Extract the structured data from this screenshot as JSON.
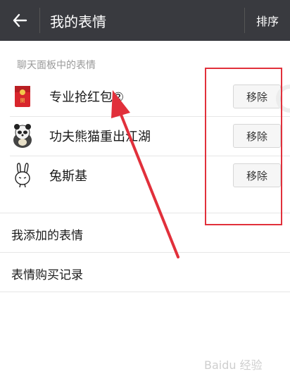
{
  "header": {
    "title": "我的表情",
    "sort_label": "排序"
  },
  "section": {
    "label": "聊天面板中的表情"
  },
  "stickers": [
    {
      "name": "专业抢红包②",
      "remove_label": "移除",
      "icon": "red-envelope-icon"
    },
    {
      "name": "功夫熊猫重出江湖",
      "remove_label": "移除",
      "icon": "kungfu-panda-icon"
    },
    {
      "name": "兔斯基",
      "remove_label": "移除",
      "icon": "tuzki-rabbit-icon"
    }
  ],
  "menu": {
    "added": "我添加的表情",
    "purchase_history": "表情购买记录"
  },
  "watermark": "Baidu 经验",
  "colors": {
    "header_bg": "#393a3f",
    "annotation_red": "#e1303b"
  }
}
